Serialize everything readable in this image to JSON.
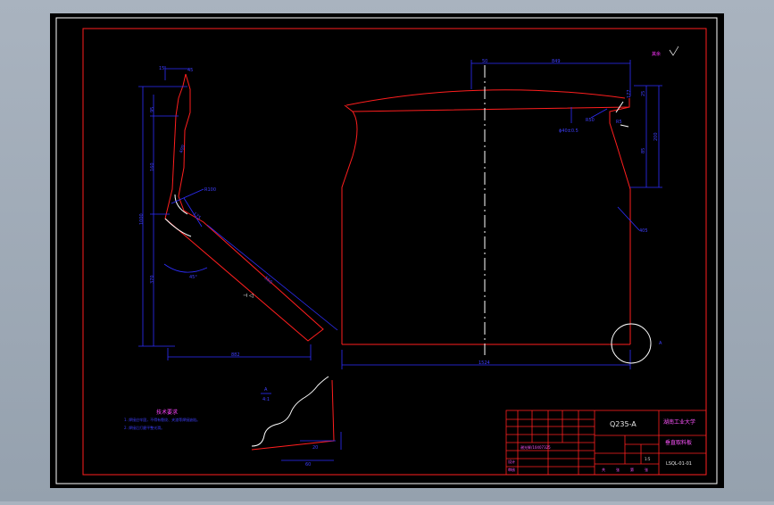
{
  "drawing": {
    "title_block": {
      "material": "Q235-A",
      "school": "湖南工业大学",
      "part_name": "垂直取料板",
      "drawing_no": "LSQL-01-01",
      "designer_field": "设计",
      "check_field": "审核",
      "scale": "1:5",
      "footer_labels": [
        "共",
        "张",
        "第",
        "张"
      ],
      "student_id": "谢光辉/10407325"
    },
    "roughness_note": "其余",
    "tech_requirements": {
      "heading": "技术要求",
      "items": [
        "1. 焊接应牢固，不得有裂纹、夹渣等焊接缺陷。",
        "2. 焊接后打磨平整光滑。"
      ]
    },
    "left_view_dims": [
      "15",
      "45",
      "95",
      "160",
      "400",
      "1000",
      "370",
      "R100",
      "175",
      "45°",
      "550",
      "882"
    ],
    "main_view_dims": [
      "50",
      "849",
      "25",
      "85",
      "200",
      "177",
      "405",
      "R50",
      "ϕ40±0.5",
      "R5",
      "1524"
    ],
    "detail_labels": [
      "A",
      "4:1",
      "20",
      "60"
    ]
  }
}
